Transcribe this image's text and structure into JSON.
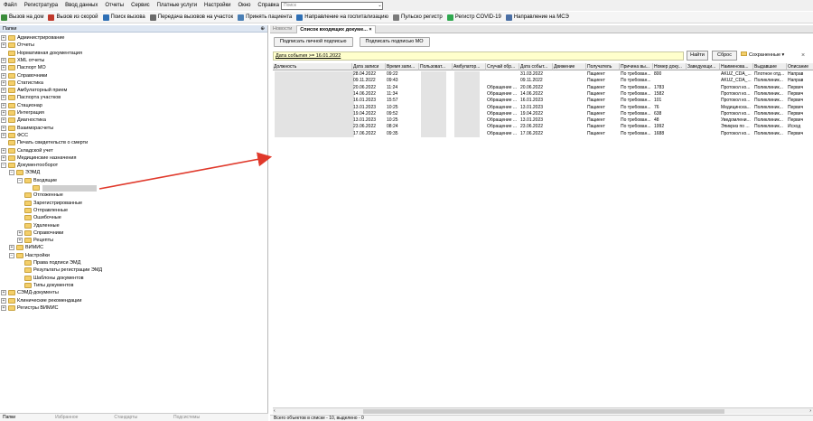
{
  "menu": [
    "Файл",
    "Регистратура",
    "Ввод данных",
    "Отчеты",
    "Сервис",
    "Платные услуги",
    "Настройки",
    "Окно",
    "Справка"
  ],
  "search": {
    "placeholder": "Поиск"
  },
  "toolbar": [
    {
      "label": "Вызов на дом",
      "color": "#3a8c3a"
    },
    {
      "label": "Вызов из скорой",
      "color": "#c0392b"
    },
    {
      "label": "Поиск вызова",
      "color": "#2e6fb5"
    },
    {
      "label": "Передача вызовов на участок",
      "color": "#6a6a6a"
    },
    {
      "label": "Принять пациента",
      "color": "#4a7fb5"
    },
    {
      "label": "Направление на госпитализацию",
      "color": "#2e6fb5"
    },
    {
      "label": "Пульско регистр",
      "color": "#7a7a7a"
    },
    {
      "label": "Регистр COVID-19",
      "color": "#2fa84f"
    },
    {
      "label": "Направление на МСЭ",
      "color": "#4a6fa5"
    }
  ],
  "left_panel": {
    "title": "Папки",
    "pin": "⊕",
    "tree": [
      {
        "label": "Администрирование",
        "level": 0,
        "expander": "+"
      },
      {
        "label": "Отчеты",
        "level": 0,
        "expander": "+"
      },
      {
        "label": "Нормативная документация",
        "level": 0,
        "expander": ""
      },
      {
        "label": "XML отчеты",
        "level": 0,
        "expander": "+"
      },
      {
        "label": "Паспорт МО",
        "level": 0,
        "expander": "+"
      },
      {
        "label": "Справочники",
        "level": 0,
        "expander": "+"
      },
      {
        "label": "Статистика",
        "level": 0,
        "expander": "+"
      },
      {
        "label": "Амбулаторный прием",
        "level": 0,
        "expander": "+"
      },
      {
        "label": "Паспорта участков",
        "level": 0,
        "expander": "+"
      },
      {
        "label": "Стационар",
        "level": 0,
        "expander": "+"
      },
      {
        "label": "Интеграция",
        "level": 0,
        "expander": "+"
      },
      {
        "label": "Диагностика",
        "level": 0,
        "expander": "+"
      },
      {
        "label": "Взаиморасчеты",
        "level": 0,
        "expander": "+"
      },
      {
        "label": "ФСС",
        "level": 0,
        "expander": "+"
      },
      {
        "label": "Печать свидетельств о смерти",
        "level": 0,
        "expander": ""
      },
      {
        "label": "Складской учет",
        "level": 0,
        "expander": "+"
      },
      {
        "label": "Медицинские назначения",
        "level": 0,
        "expander": "+"
      },
      {
        "label": "Документооборот",
        "level": 0,
        "expander": "−"
      },
      {
        "label": "ЭЭМД",
        "level": 1,
        "expander": "−"
      },
      {
        "label": "Входящие",
        "level": 2,
        "expander": "−"
      },
      {
        "label": "",
        "level": 3,
        "expander": "",
        "blurred": true
      },
      {
        "label": "Отложенные",
        "level": 2,
        "expander": ""
      },
      {
        "label": "Зарегистрированные",
        "level": 2,
        "expander": ""
      },
      {
        "label": "Отправленные",
        "level": 2,
        "expander": ""
      },
      {
        "label": "Ошибочные",
        "level": 2,
        "expander": ""
      },
      {
        "label": "Удаленные",
        "level": 2,
        "expander": ""
      },
      {
        "label": "Справочники",
        "level": 2,
        "expander": "+"
      },
      {
        "label": "Рецепты",
        "level": 2,
        "expander": "+"
      },
      {
        "label": "ВИМИС",
        "level": 1,
        "expander": "+"
      },
      {
        "label": "Настройки",
        "level": 1,
        "expander": "−"
      },
      {
        "label": "Права подписи ЭМД",
        "level": 2,
        "expander": ""
      },
      {
        "label": "Результаты регистрации ЭМД",
        "level": 2,
        "expander": ""
      },
      {
        "label": "Шаблоны документов",
        "level": 2,
        "expander": ""
      },
      {
        "label": "Типы документов",
        "level": 2,
        "expander": ""
      },
      {
        "label": "СЭМД-документы",
        "level": 0,
        "expander": "+"
      },
      {
        "label": "Клинические рекомендации",
        "level": 0,
        "expander": "+"
      },
      {
        "label": "Регистры ВИМИС",
        "level": 0,
        "expander": "+"
      }
    ],
    "footer": [
      "Папки",
      "Избранное",
      "Стандарты",
      "Подсистемы"
    ]
  },
  "tabs": [
    {
      "label": "Новости",
      "active": false
    },
    {
      "label": "Список входящих докуме... ×",
      "active": true
    }
  ],
  "buttons": {
    "sign_personal": "Подписать личной подписью",
    "sign_mo": "Подписать подписью МО"
  },
  "filter": {
    "text": "Дата события >= 16.01.2022",
    "find": "Найти",
    "reset": "Сброс",
    "saved": "Сохраненные ▾",
    "close": "×"
  },
  "grid": {
    "columns": [
      "Должность",
      "Дата записи",
      "Время запи...",
      "Пользоват...",
      "Амбулатор...",
      "Случай обр...",
      "Дата событ...",
      "Движение",
      "Получатель",
      "Причина вы...",
      "Номер доку...",
      "Заведующи...",
      "Наименова...",
      "Выдавшие",
      "Описание"
    ],
    "rows": [
      [
        "",
        "28.04.2022",
        "09:22",
        "",
        "",
        "",
        "31.03.2022",
        "",
        "Пациент",
        "По требован...",
        "800",
        "",
        "AKUZ_CDA_...",
        "Плотное отд...",
        "Направ"
      ],
      [
        "",
        "09.11.2022",
        "09:43",
        "",
        "",
        "",
        "09.11.2022",
        "",
        "Пациент",
        "По требован...",
        "",
        "",
        "AKUZ_CDA_...",
        "Поликлиник...",
        "Направ"
      ],
      [
        "",
        "20.06.2022",
        "11:24",
        "",
        "",
        "Обращение ...",
        "20.06.2022",
        "",
        "Пациент",
        "По требован...",
        "1783",
        "",
        "Протокол ко...",
        "Поликлиник...",
        "Первич"
      ],
      [
        "",
        "14.06.2022",
        "11:34",
        "",
        "",
        "Обращение ...",
        "14.06.2022",
        "",
        "Пациент",
        "По требован...",
        "1582",
        "",
        "Протокол ко...",
        "Поликлиник...",
        "Первич"
      ],
      [
        "",
        "16.01.2023",
        "15:57",
        "",
        "",
        "Обращение ...",
        "16.01.2023",
        "",
        "Пациент",
        "По требован...",
        "101",
        "",
        "Протокол ко...",
        "Поликлиник...",
        "Первич"
      ],
      [
        "",
        "13.01.2023",
        "10:25",
        "",
        "",
        "Обращение ...",
        "13.01.2023",
        "",
        "Пациент",
        "По требован...",
        "76",
        "",
        "Медицинска...",
        "Поликлиник...",
        "Первич"
      ],
      [
        "",
        "19.04.2022",
        "09:52",
        "",
        "",
        "Обращение ...",
        "19.04.2022",
        "",
        "Пациент",
        "По требован...",
        "638",
        "",
        "Протокол ко...",
        "Поликлиник...",
        "Первич"
      ],
      [
        "",
        "13.01.2023",
        "10:25",
        "",
        "",
        "Обращение ...",
        "13.01.2023",
        "",
        "Пациент",
        "По требован...",
        "48",
        "",
        "Уведомлени...",
        "Поликлиник...",
        "Первич"
      ],
      [
        "",
        "23.06.2022",
        "08:24",
        "",
        "",
        "Обращение ...",
        "23.06.2022",
        "",
        "Пациент",
        "По требован...",
        "1992",
        "",
        "Эпикриз по ...",
        "Поликлиник...",
        "Исход"
      ],
      [
        "",
        "17.06.2022",
        "09:35",
        "",
        "",
        "Обращение ...",
        "17.06.2022",
        "",
        "Пациент",
        "По требован...",
        "1688",
        "",
        "Протокол ко...",
        "Поликлиник...",
        "Первич"
      ]
    ]
  },
  "status": "Всего объектов в списке - 10, выделено - 0",
  "colors": {
    "arrow": "#e0392b",
    "accent": "#dde6f2"
  }
}
